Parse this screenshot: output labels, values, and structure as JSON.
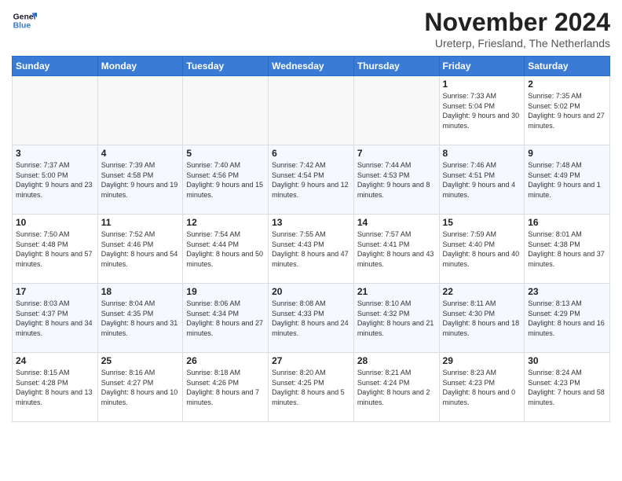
{
  "header": {
    "logo_general": "General",
    "logo_blue": "Blue",
    "month_title": "November 2024",
    "location": "Ureterp, Friesland, The Netherlands"
  },
  "weekdays": [
    "Sunday",
    "Monday",
    "Tuesday",
    "Wednesday",
    "Thursday",
    "Friday",
    "Saturday"
  ],
  "weeks": [
    [
      {
        "day": "",
        "info": ""
      },
      {
        "day": "",
        "info": ""
      },
      {
        "day": "",
        "info": ""
      },
      {
        "day": "",
        "info": ""
      },
      {
        "day": "",
        "info": ""
      },
      {
        "day": "1",
        "info": "Sunrise: 7:33 AM\nSunset: 5:04 PM\nDaylight: 9 hours and 30 minutes."
      },
      {
        "day": "2",
        "info": "Sunrise: 7:35 AM\nSunset: 5:02 PM\nDaylight: 9 hours and 27 minutes."
      }
    ],
    [
      {
        "day": "3",
        "info": "Sunrise: 7:37 AM\nSunset: 5:00 PM\nDaylight: 9 hours and 23 minutes."
      },
      {
        "day": "4",
        "info": "Sunrise: 7:39 AM\nSunset: 4:58 PM\nDaylight: 9 hours and 19 minutes."
      },
      {
        "day": "5",
        "info": "Sunrise: 7:40 AM\nSunset: 4:56 PM\nDaylight: 9 hours and 15 minutes."
      },
      {
        "day": "6",
        "info": "Sunrise: 7:42 AM\nSunset: 4:54 PM\nDaylight: 9 hours and 12 minutes."
      },
      {
        "day": "7",
        "info": "Sunrise: 7:44 AM\nSunset: 4:53 PM\nDaylight: 9 hours and 8 minutes."
      },
      {
        "day": "8",
        "info": "Sunrise: 7:46 AM\nSunset: 4:51 PM\nDaylight: 9 hours and 4 minutes."
      },
      {
        "day": "9",
        "info": "Sunrise: 7:48 AM\nSunset: 4:49 PM\nDaylight: 9 hours and 1 minute."
      }
    ],
    [
      {
        "day": "10",
        "info": "Sunrise: 7:50 AM\nSunset: 4:48 PM\nDaylight: 8 hours and 57 minutes."
      },
      {
        "day": "11",
        "info": "Sunrise: 7:52 AM\nSunset: 4:46 PM\nDaylight: 8 hours and 54 minutes."
      },
      {
        "day": "12",
        "info": "Sunrise: 7:54 AM\nSunset: 4:44 PM\nDaylight: 8 hours and 50 minutes."
      },
      {
        "day": "13",
        "info": "Sunrise: 7:55 AM\nSunset: 4:43 PM\nDaylight: 8 hours and 47 minutes."
      },
      {
        "day": "14",
        "info": "Sunrise: 7:57 AM\nSunset: 4:41 PM\nDaylight: 8 hours and 43 minutes."
      },
      {
        "day": "15",
        "info": "Sunrise: 7:59 AM\nSunset: 4:40 PM\nDaylight: 8 hours and 40 minutes."
      },
      {
        "day": "16",
        "info": "Sunrise: 8:01 AM\nSunset: 4:38 PM\nDaylight: 8 hours and 37 minutes."
      }
    ],
    [
      {
        "day": "17",
        "info": "Sunrise: 8:03 AM\nSunset: 4:37 PM\nDaylight: 8 hours and 34 minutes."
      },
      {
        "day": "18",
        "info": "Sunrise: 8:04 AM\nSunset: 4:35 PM\nDaylight: 8 hours and 31 minutes."
      },
      {
        "day": "19",
        "info": "Sunrise: 8:06 AM\nSunset: 4:34 PM\nDaylight: 8 hours and 27 minutes."
      },
      {
        "day": "20",
        "info": "Sunrise: 8:08 AM\nSunset: 4:33 PM\nDaylight: 8 hours and 24 minutes."
      },
      {
        "day": "21",
        "info": "Sunrise: 8:10 AM\nSunset: 4:32 PM\nDaylight: 8 hours and 21 minutes."
      },
      {
        "day": "22",
        "info": "Sunrise: 8:11 AM\nSunset: 4:30 PM\nDaylight: 8 hours and 18 minutes."
      },
      {
        "day": "23",
        "info": "Sunrise: 8:13 AM\nSunset: 4:29 PM\nDaylight: 8 hours and 16 minutes."
      }
    ],
    [
      {
        "day": "24",
        "info": "Sunrise: 8:15 AM\nSunset: 4:28 PM\nDaylight: 8 hours and 13 minutes."
      },
      {
        "day": "25",
        "info": "Sunrise: 8:16 AM\nSunset: 4:27 PM\nDaylight: 8 hours and 10 minutes."
      },
      {
        "day": "26",
        "info": "Sunrise: 8:18 AM\nSunset: 4:26 PM\nDaylight: 8 hours and 7 minutes."
      },
      {
        "day": "27",
        "info": "Sunrise: 8:20 AM\nSunset: 4:25 PM\nDaylight: 8 hours and 5 minutes."
      },
      {
        "day": "28",
        "info": "Sunrise: 8:21 AM\nSunset: 4:24 PM\nDaylight: 8 hours and 2 minutes."
      },
      {
        "day": "29",
        "info": "Sunrise: 8:23 AM\nSunset: 4:23 PM\nDaylight: 8 hours and 0 minutes."
      },
      {
        "day": "30",
        "info": "Sunrise: 8:24 AM\nSunset: 4:23 PM\nDaylight: 7 hours and 58 minutes."
      }
    ]
  ]
}
